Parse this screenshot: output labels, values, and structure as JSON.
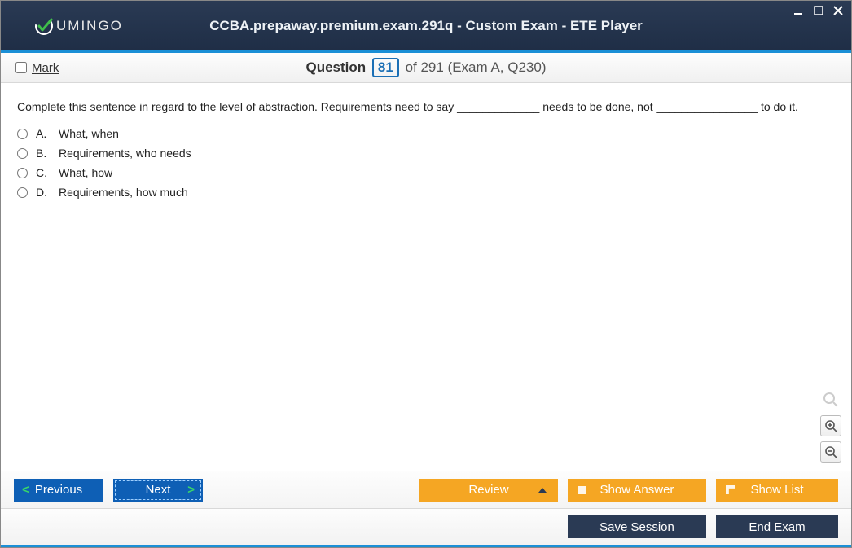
{
  "brand": {
    "name": "UMINGO"
  },
  "window": {
    "title": "CCBA.prepaway.premium.exam.291q - Custom Exam - ETE Player"
  },
  "mark": {
    "label": "Mark",
    "checked": false
  },
  "question_bar": {
    "word": "Question",
    "number": "81",
    "suffix": "of 291 (Exam A, Q230)"
  },
  "question": {
    "text": "Complete this sentence in regard to the level of abstraction. Requirements need to say _____________ needs to be done, not ________________ to do it.",
    "options": [
      {
        "letter": "A.",
        "text": "What, when"
      },
      {
        "letter": "B.",
        "text": "Requirements, who needs"
      },
      {
        "letter": "C.",
        "text": "What, how"
      },
      {
        "letter": "D.",
        "text": "Requirements, how much"
      }
    ]
  },
  "buttons": {
    "previous": "Previous",
    "next": "Next",
    "review": "Review",
    "show_answer": "Show Answer",
    "show_list": "Show List",
    "save_session": "Save Session",
    "end_exam": "End Exam"
  }
}
